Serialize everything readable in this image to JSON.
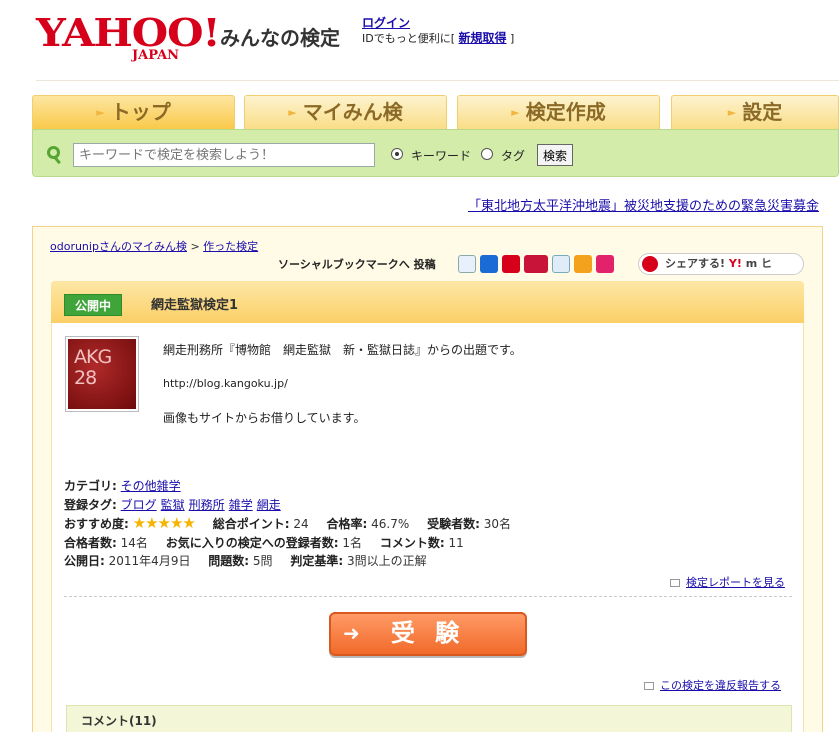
{
  "header": {
    "logo_text": "YAHOO!",
    "logo_sub": "JAPAN",
    "site_title": "みんなの検定",
    "login_label": "ログイン",
    "login_note_prefix": "IDでもっと便利に[",
    "signup_label": "新規取得",
    "login_note_suffix": "]"
  },
  "tabs": [
    {
      "label": "トップ"
    },
    {
      "label": "マイみん検"
    },
    {
      "label": "検定作成"
    },
    {
      "label": "設定"
    }
  ],
  "search": {
    "placeholder": "キーワードで検定を検索しよう！",
    "option_keyword": "キーワード",
    "option_tag": "タグ",
    "button_label": "検索"
  },
  "disaster_link": "「東北地方太平洋沖地震」被災地支援のための緊急災害募金",
  "breadcrumb": {
    "user": "odorunipさんのマイみん検",
    "sep": " > ",
    "current": "作った検定"
  },
  "social": {
    "label": "ソーシャルブックマークへ 投稿",
    "share_label": "シェアする!",
    "share_yahoo": "Y!",
    "share_rest": "m ヒ"
  },
  "quiz": {
    "status": "公開中",
    "title": "網走監獄検定1",
    "thumb_text": "AKG 28",
    "desc_line1": "網走刑務所『博物館　網走監獄　新・監獄日誌』からの出題です。",
    "desc_url": "http://blog.kangoku.jp/",
    "desc_note": "画像もサイトからお借りしています。",
    "category_label": "カテゴリ:",
    "category": "その他雑学",
    "tags_label": "登録タグ:",
    "tags": [
      "ブログ",
      "監獄",
      "刑務所",
      "雑学",
      "網走"
    ],
    "recommend_label": "おすすめ度:",
    "stars": "★★★★★",
    "points_label": "総合ポイント:",
    "points": "24",
    "pass_rate_label": "合格率:",
    "pass_rate": "46.7%",
    "examinees_label": "受験者数:",
    "examinees": "30名",
    "passers_label": "合格者数:",
    "passers": "14名",
    "favorites_label": "お気に入りの検定への登録者数:",
    "favorites": "1名",
    "comments_label": "コメント数:",
    "comments": "11",
    "published_label": "公開日:",
    "published": "2011年4月9日",
    "questions_label": "問題数:",
    "questions": "5問",
    "criteria_label": "判定基準:",
    "criteria": "3問以上の正解",
    "report_link": "検定レポートを見る",
    "take_button": "受 験",
    "violation_link": "この検定を違反報告する",
    "comment_header": "コメント(11)"
  }
}
